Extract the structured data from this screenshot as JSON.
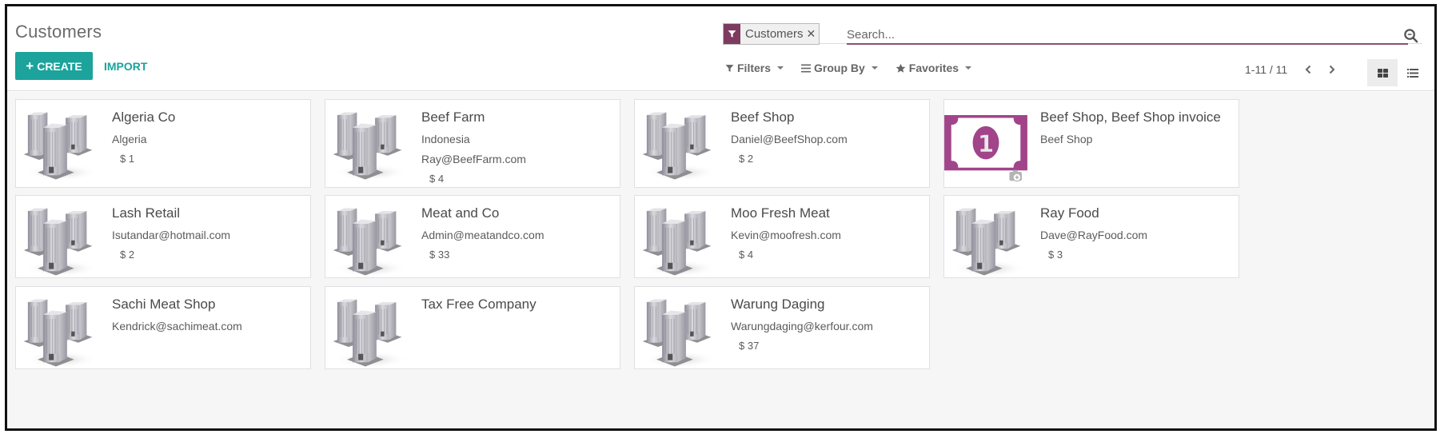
{
  "header": {
    "title": "Customers",
    "create_label": "CREATE",
    "import_label": "IMPORT"
  },
  "search": {
    "facet_label": "Customers",
    "facet_icon": "filter-icon",
    "placeholder": "Search...",
    "value": ""
  },
  "search_options": {
    "filters_label": "Filters",
    "group_by_label": "Group By",
    "favorites_label": "Favorites"
  },
  "pager": {
    "value": "1-11 / 11"
  },
  "view_switcher": {
    "active": "kanban",
    "options": [
      "kanban",
      "list"
    ]
  },
  "colors": {
    "primary": "#1ba39c",
    "facet": "#7c3b5f",
    "search_underline": "#8d4f6f",
    "bill_icon": "#a1448a"
  },
  "customers": [
    {
      "name": "Algeria Co",
      "lines": [
        "Algeria"
      ],
      "amount": "$ 1",
      "image": "company-buildings"
    },
    {
      "name": "Beef Farm",
      "lines": [
        "Indonesia",
        "Ray@BeefFarm.com"
      ],
      "amount": "$ 4",
      "image": "company-buildings"
    },
    {
      "name": "Beef Shop",
      "lines": [
        "Daniel@BeefShop.com"
      ],
      "amount": "$ 2",
      "image": "company-buildings"
    },
    {
      "name": "Beef Shop, Beef Shop invoice",
      "lines": [
        "Beef Shop"
      ],
      "amount": "",
      "image": "money-bill"
    },
    {
      "name": "Lash Retail",
      "lines": [
        "Isutandar@hotmail.com"
      ],
      "amount": "$ 2",
      "image": "company-buildings"
    },
    {
      "name": "Meat and Co",
      "lines": [
        "Admin@meatandco.com"
      ],
      "amount": "$ 33",
      "image": "company-buildings"
    },
    {
      "name": "Moo Fresh Meat",
      "lines": [
        "Kevin@moofresh.com"
      ],
      "amount": "$ 4",
      "image": "company-buildings"
    },
    {
      "name": "Ray Food",
      "lines": [
        "Dave@RayFood.com"
      ],
      "amount": "$ 3",
      "image": "company-buildings"
    },
    {
      "name": "Sachi Meat Shop",
      "lines": [
        "Kendrick@sachimeat.com"
      ],
      "amount": "",
      "image": "company-buildings"
    },
    {
      "name": "Tax Free Company",
      "lines": [],
      "amount": "",
      "image": "company-buildings"
    },
    {
      "name": "Warung Daging",
      "lines": [
        "Warungdaging@kerfour.com"
      ],
      "amount": "$ 37",
      "image": "company-buildings"
    }
  ]
}
